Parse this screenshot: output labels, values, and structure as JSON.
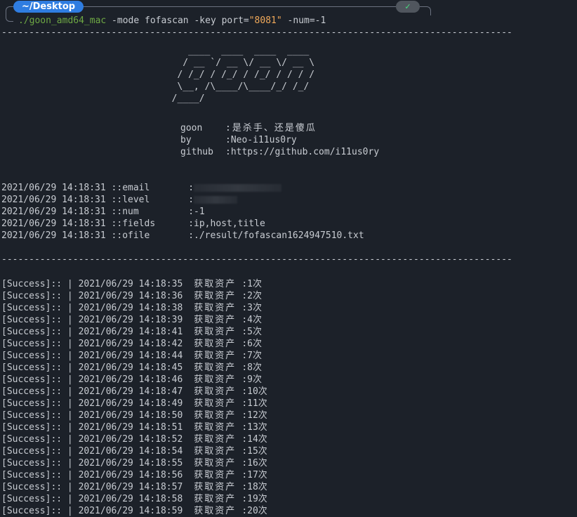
{
  "prompt": {
    "path": "~/Desktop",
    "status_icon": "✓",
    "executable": "./goon_amd64_mac",
    "args_before": " -mode fofascan -key port=",
    "quoted_value": "\"8081\"",
    "args_after": " -num=-1"
  },
  "rule_line": "---------------------------------------------------------------------------------------------",
  "banner": [
    "                                  ____  ____  ____  ____ ",
    "                                 / __ `/ __ \\/ __ \\/ __ \\",
    "                                / /_/ / /_/ / /_/ / / / /",
    "                                \\__, /\\____/\\____/_/ /_/ ",
    "                               /____/                    "
  ],
  "about": [
    {
      "key": "goon",
      "value": ":是杀手、还是傻瓜"
    },
    {
      "key": "by",
      "value": ":Neo-i11us0ry"
    },
    {
      "key": "github",
      "value": ":https://github.com/i11us0ry"
    }
  ],
  "config": [
    {
      "time": "2021/06/29 14:18:31",
      "key": "email",
      "value": ""
    },
    {
      "time": "2021/06/29 14:18:31",
      "key": "level",
      "value": ""
    },
    {
      "time": "2021/06/29 14:18:31",
      "key": "num",
      "value": ":-1"
    },
    {
      "time": "2021/06/29 14:18:31",
      "key": "fields",
      "value": ":ip,host,title"
    },
    {
      "time": "2021/06/29 14:18:31",
      "key": "ofile",
      "value": ":./result/fofascan1624947510.txt"
    }
  ],
  "result_prefix": "[Success]:: | ",
  "result_label": "获取资产",
  "results": [
    {
      "time": "2021/06/29 14:18:35",
      "count": ":1次"
    },
    {
      "time": "2021/06/29 14:18:36",
      "count": ":2次"
    },
    {
      "time": "2021/06/29 14:18:38",
      "count": ":3次"
    },
    {
      "time": "2021/06/29 14:18:39",
      "count": ":4次"
    },
    {
      "time": "2021/06/29 14:18:41",
      "count": ":5次"
    },
    {
      "time": "2021/06/29 14:18:42",
      "count": ":6次"
    },
    {
      "time": "2021/06/29 14:18:44",
      "count": ":7次"
    },
    {
      "time": "2021/06/29 14:18:45",
      "count": ":8次"
    },
    {
      "time": "2021/06/29 14:18:46",
      "count": ":9次"
    },
    {
      "time": "2021/06/29 14:18:47",
      "count": ":10次"
    },
    {
      "time": "2021/06/29 14:18:49",
      "count": ":11次"
    },
    {
      "time": "2021/06/29 14:18:50",
      "count": ":12次"
    },
    {
      "time": "2021/06/29 14:18:51",
      "count": ":13次"
    },
    {
      "time": "2021/06/29 14:18:52",
      "count": ":14次"
    },
    {
      "time": "2021/06/29 14:18:54",
      "count": ":15次"
    },
    {
      "time": "2021/06/29 14:18:55",
      "count": ":16次"
    },
    {
      "time": "2021/06/29 14:18:56",
      "count": ":17次"
    },
    {
      "time": "2021/06/29 14:18:57",
      "count": ":18次"
    },
    {
      "time": "2021/06/29 14:18:58",
      "count": ":19次"
    },
    {
      "time": "2021/06/29 14:18:59",
      "count": ":20次"
    }
  ]
}
